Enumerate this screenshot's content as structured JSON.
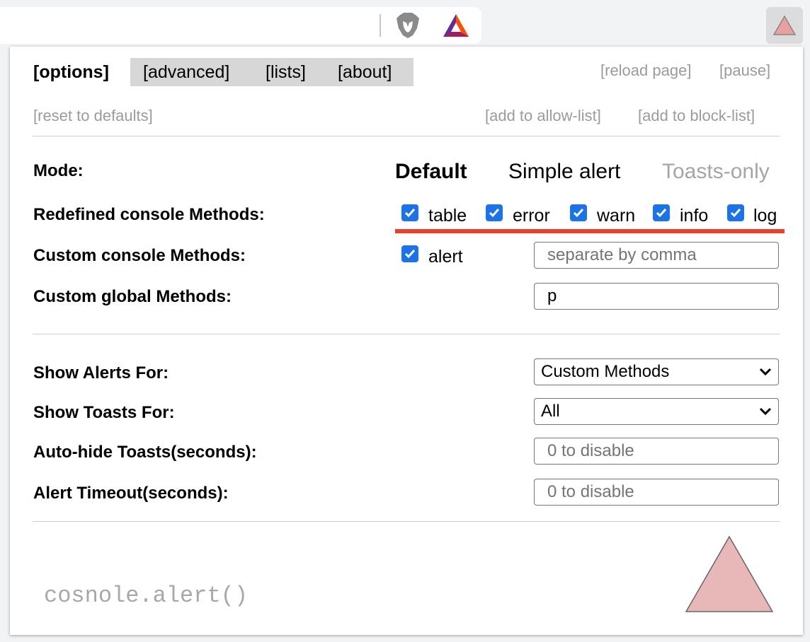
{
  "browser": {
    "icons": [
      "brave-lion-icon",
      "bat-triangle-icon",
      "extension-triangle-icon"
    ]
  },
  "tabs": {
    "options": "[options]",
    "advanced": "[advanced]",
    "lists": "[lists]",
    "about": "[about]"
  },
  "actions": {
    "reload": "[reload page]",
    "pause": "[pause]",
    "reset": "[reset to defaults]",
    "allow": "[add to allow-list]",
    "block": "[add to block-list]"
  },
  "mode": {
    "label": "Mode:",
    "default": "Default",
    "simple": "Simple alert",
    "toasts": "Toasts-only",
    "selected": "Default"
  },
  "redefined": {
    "label": "Redefined console Methods:",
    "methods": [
      "table",
      "error",
      "warn",
      "info",
      "log"
    ]
  },
  "custom_console": {
    "label": "Custom console Methods:",
    "checkbox": "alert",
    "placeholder": "separate by comma"
  },
  "custom_global": {
    "label": "Custom global Methods:",
    "value": "p"
  },
  "show_alerts": {
    "label": "Show Alerts For:",
    "value": "Custom Methods"
  },
  "show_toasts": {
    "label": "Show Toasts For:",
    "value": "All"
  },
  "autohide": {
    "label": "Auto-hide Toasts(seconds):",
    "placeholder": "0 to disable"
  },
  "alert_timeout": {
    "label": "Alert Timeout(seconds):",
    "placeholder": "0 to disable"
  },
  "footer": {
    "code": "cosnole.alert()"
  },
  "colors": {
    "checkbox": "#1a73e8",
    "underline": "#e5412d",
    "logo_fill": "#e8b8b8"
  }
}
